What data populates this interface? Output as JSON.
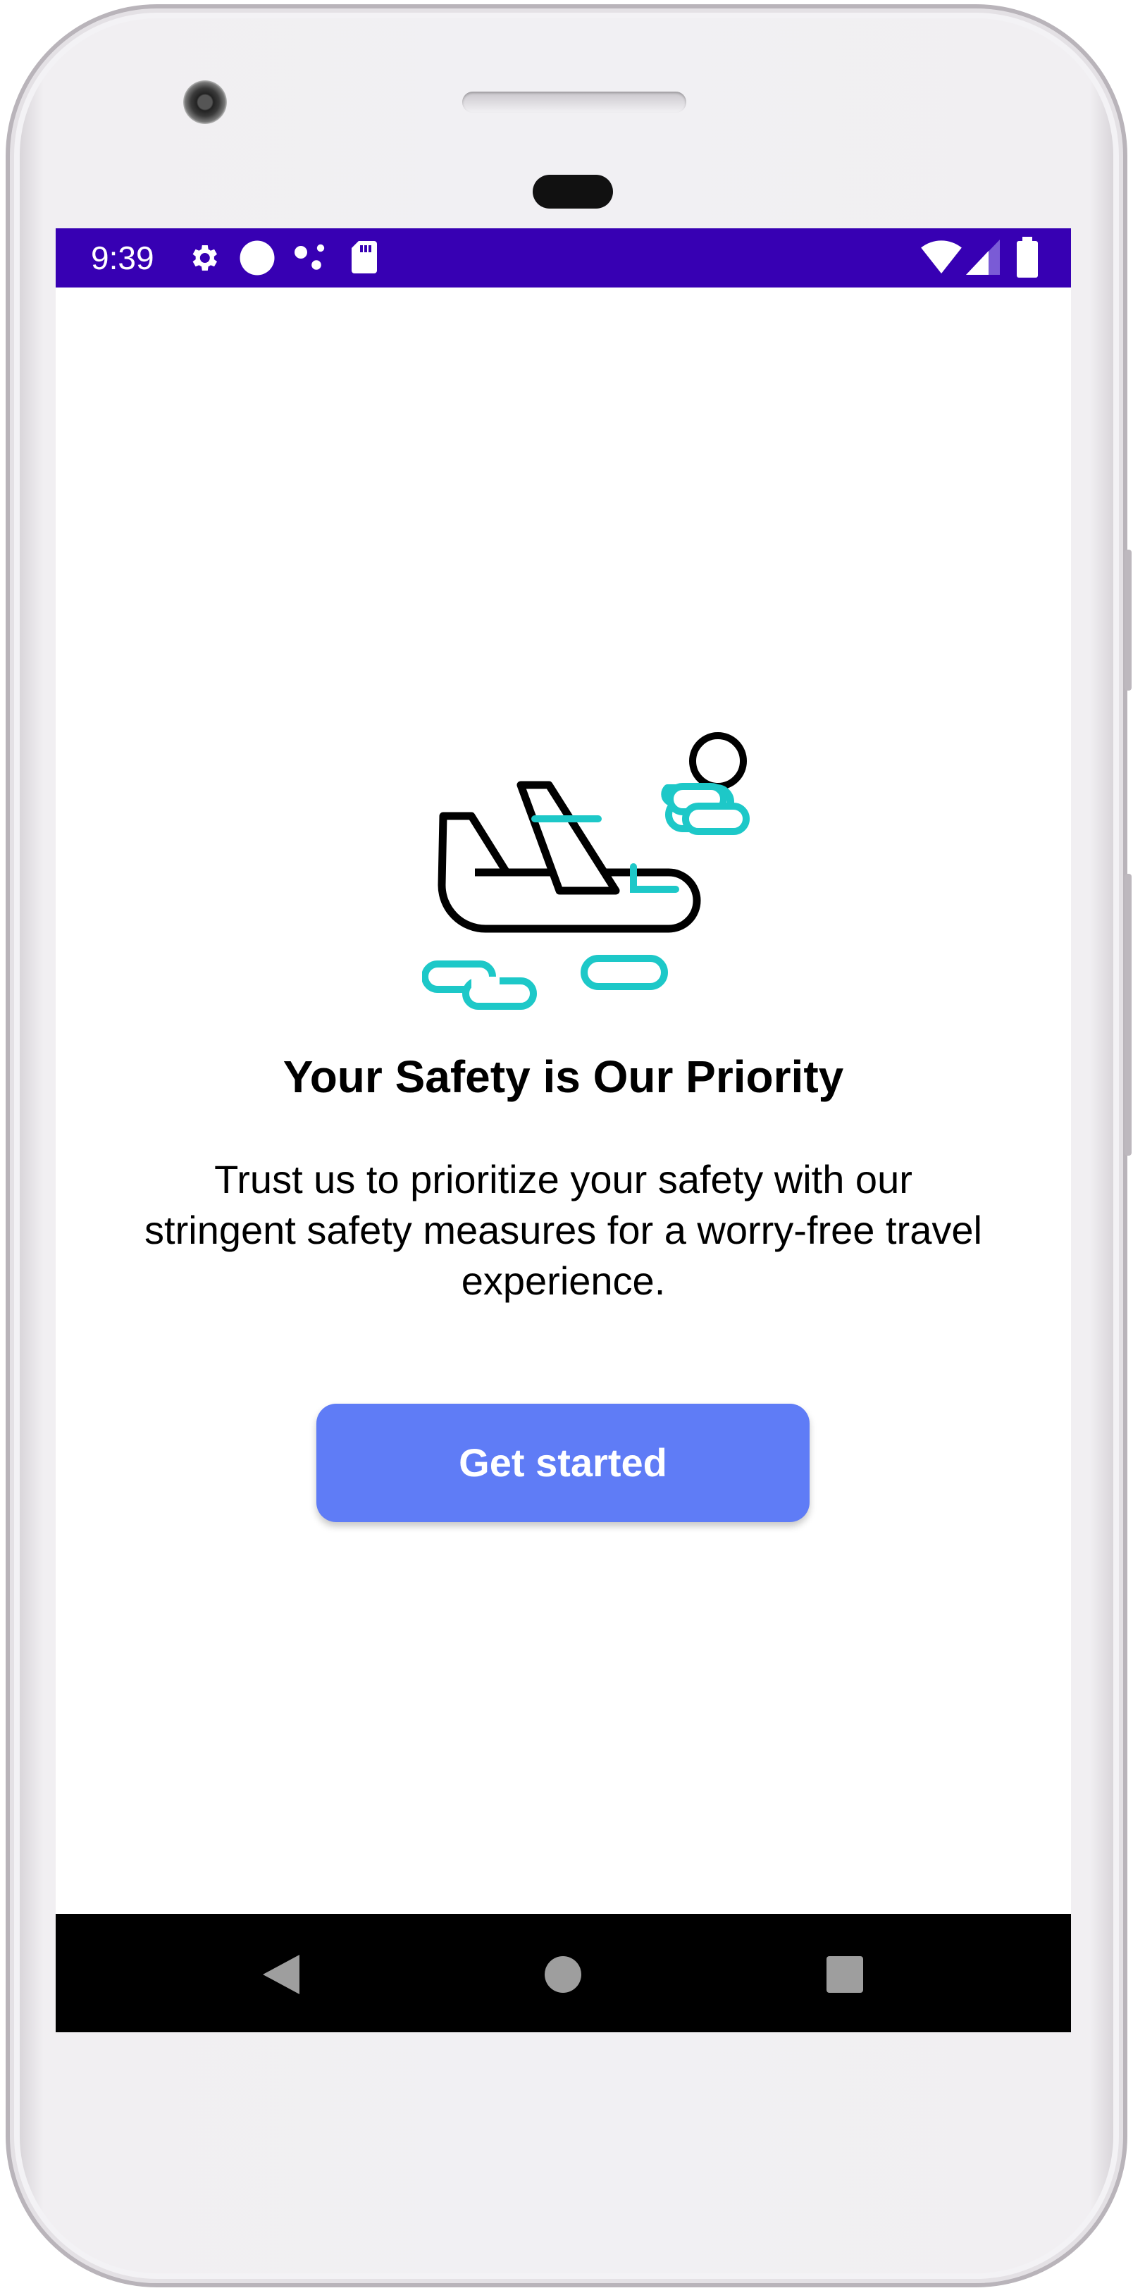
{
  "status_bar": {
    "time": "9:39",
    "icons_left": [
      "gear-icon",
      "circle-icon",
      "dots-icon",
      "sd-card-icon"
    ],
    "icons_right": [
      "wifi-icon",
      "signal-icon",
      "battery-icon"
    ],
    "background": "#3700b3"
  },
  "onboarding": {
    "illustration": "airplane-with-clouds-illustration",
    "title": "Your Safety is Our Priority",
    "description": "Trust us to prioritize your safety with our stringent safety measures for a worry-free travel experience.",
    "cta_label": "Get started",
    "cta_color": "#5f7cf6",
    "accent_color": "#1dc8c8"
  },
  "nav_bar": {
    "buttons": [
      "back-icon",
      "home-icon",
      "recents-icon"
    ]
  }
}
